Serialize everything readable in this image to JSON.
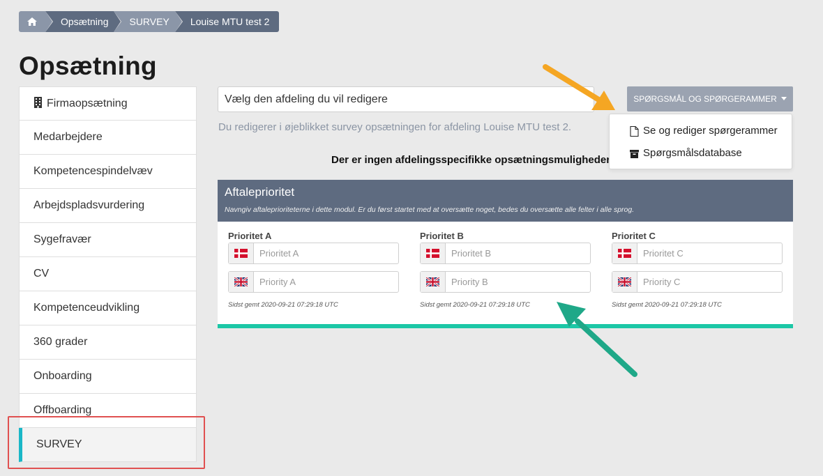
{
  "breadcrumb": {
    "home_icon": "home-icon",
    "items": [
      "Opsætning",
      "SURVEY",
      "Louise MTU test 2"
    ]
  },
  "page_title": "Opsætning",
  "sidebar": {
    "items": [
      {
        "label": "Firmaopsætning",
        "icon": "building-icon"
      },
      {
        "label": "Medarbejdere"
      },
      {
        "label": "Kompetencespindelvæv"
      },
      {
        "label": "Arbejdspladsvurdering"
      },
      {
        "label": "Sygefravær"
      },
      {
        "label": "CV"
      },
      {
        "label": "Kompetenceudvikling"
      },
      {
        "label": "360 grader"
      },
      {
        "label": "Onboarding"
      },
      {
        "label": "Offboarding"
      },
      {
        "label": "SURVEY",
        "active": true
      }
    ]
  },
  "department_select": {
    "placeholder": "Vælg den afdeling du vil redigere"
  },
  "menu_button": {
    "label": "SPØRGSMÅL OG SPØRGERAMMER"
  },
  "dropdown": {
    "items": [
      {
        "label": "Se og rediger spørgerammer",
        "icon": "file-icon"
      },
      {
        "label": "Spørgsmålsdatabase",
        "icon": "archive-icon"
      }
    ]
  },
  "info_text": "Du redigerer i øjeblikket survey opsætningen for afdeling Louise MTU test 2.",
  "no_options_text": "Der er ingen afdelingsspecifikke opsætningsmuligheder t",
  "panel": {
    "title": "Aftaleprioritet",
    "subtitle": "Navngiv aftaleprioriteterne i dette modul. Er du først startet med at oversætte noget, bedes du oversætte alle felter i alle sprog.",
    "columns": [
      {
        "label": "Prioritet A",
        "da_placeholder": "Prioritet A",
        "en_placeholder": "Priority A",
        "saved": "Sidst gemt 2020-09-21 07:29:18 UTC"
      },
      {
        "label": "Prioritet B",
        "da_placeholder": "Prioritet B",
        "en_placeholder": "Priority B",
        "saved": "Sidst gemt 2020-09-21 07:29:18 UTC"
      },
      {
        "label": "Prioritet C",
        "da_placeholder": "Prioritet C",
        "en_placeholder": "Priority C",
        "saved": "Sidst gemt 2020-09-21 07:29:18 UTC"
      }
    ]
  },
  "colors": {
    "accent_teal": "#1cc7a6",
    "active_bar": "#1ab7c7",
    "header_slate": "#5e6b80",
    "annotation_orange": "#f5a623",
    "annotation_green": "#1fa888",
    "annotation_red": "#e05050"
  }
}
